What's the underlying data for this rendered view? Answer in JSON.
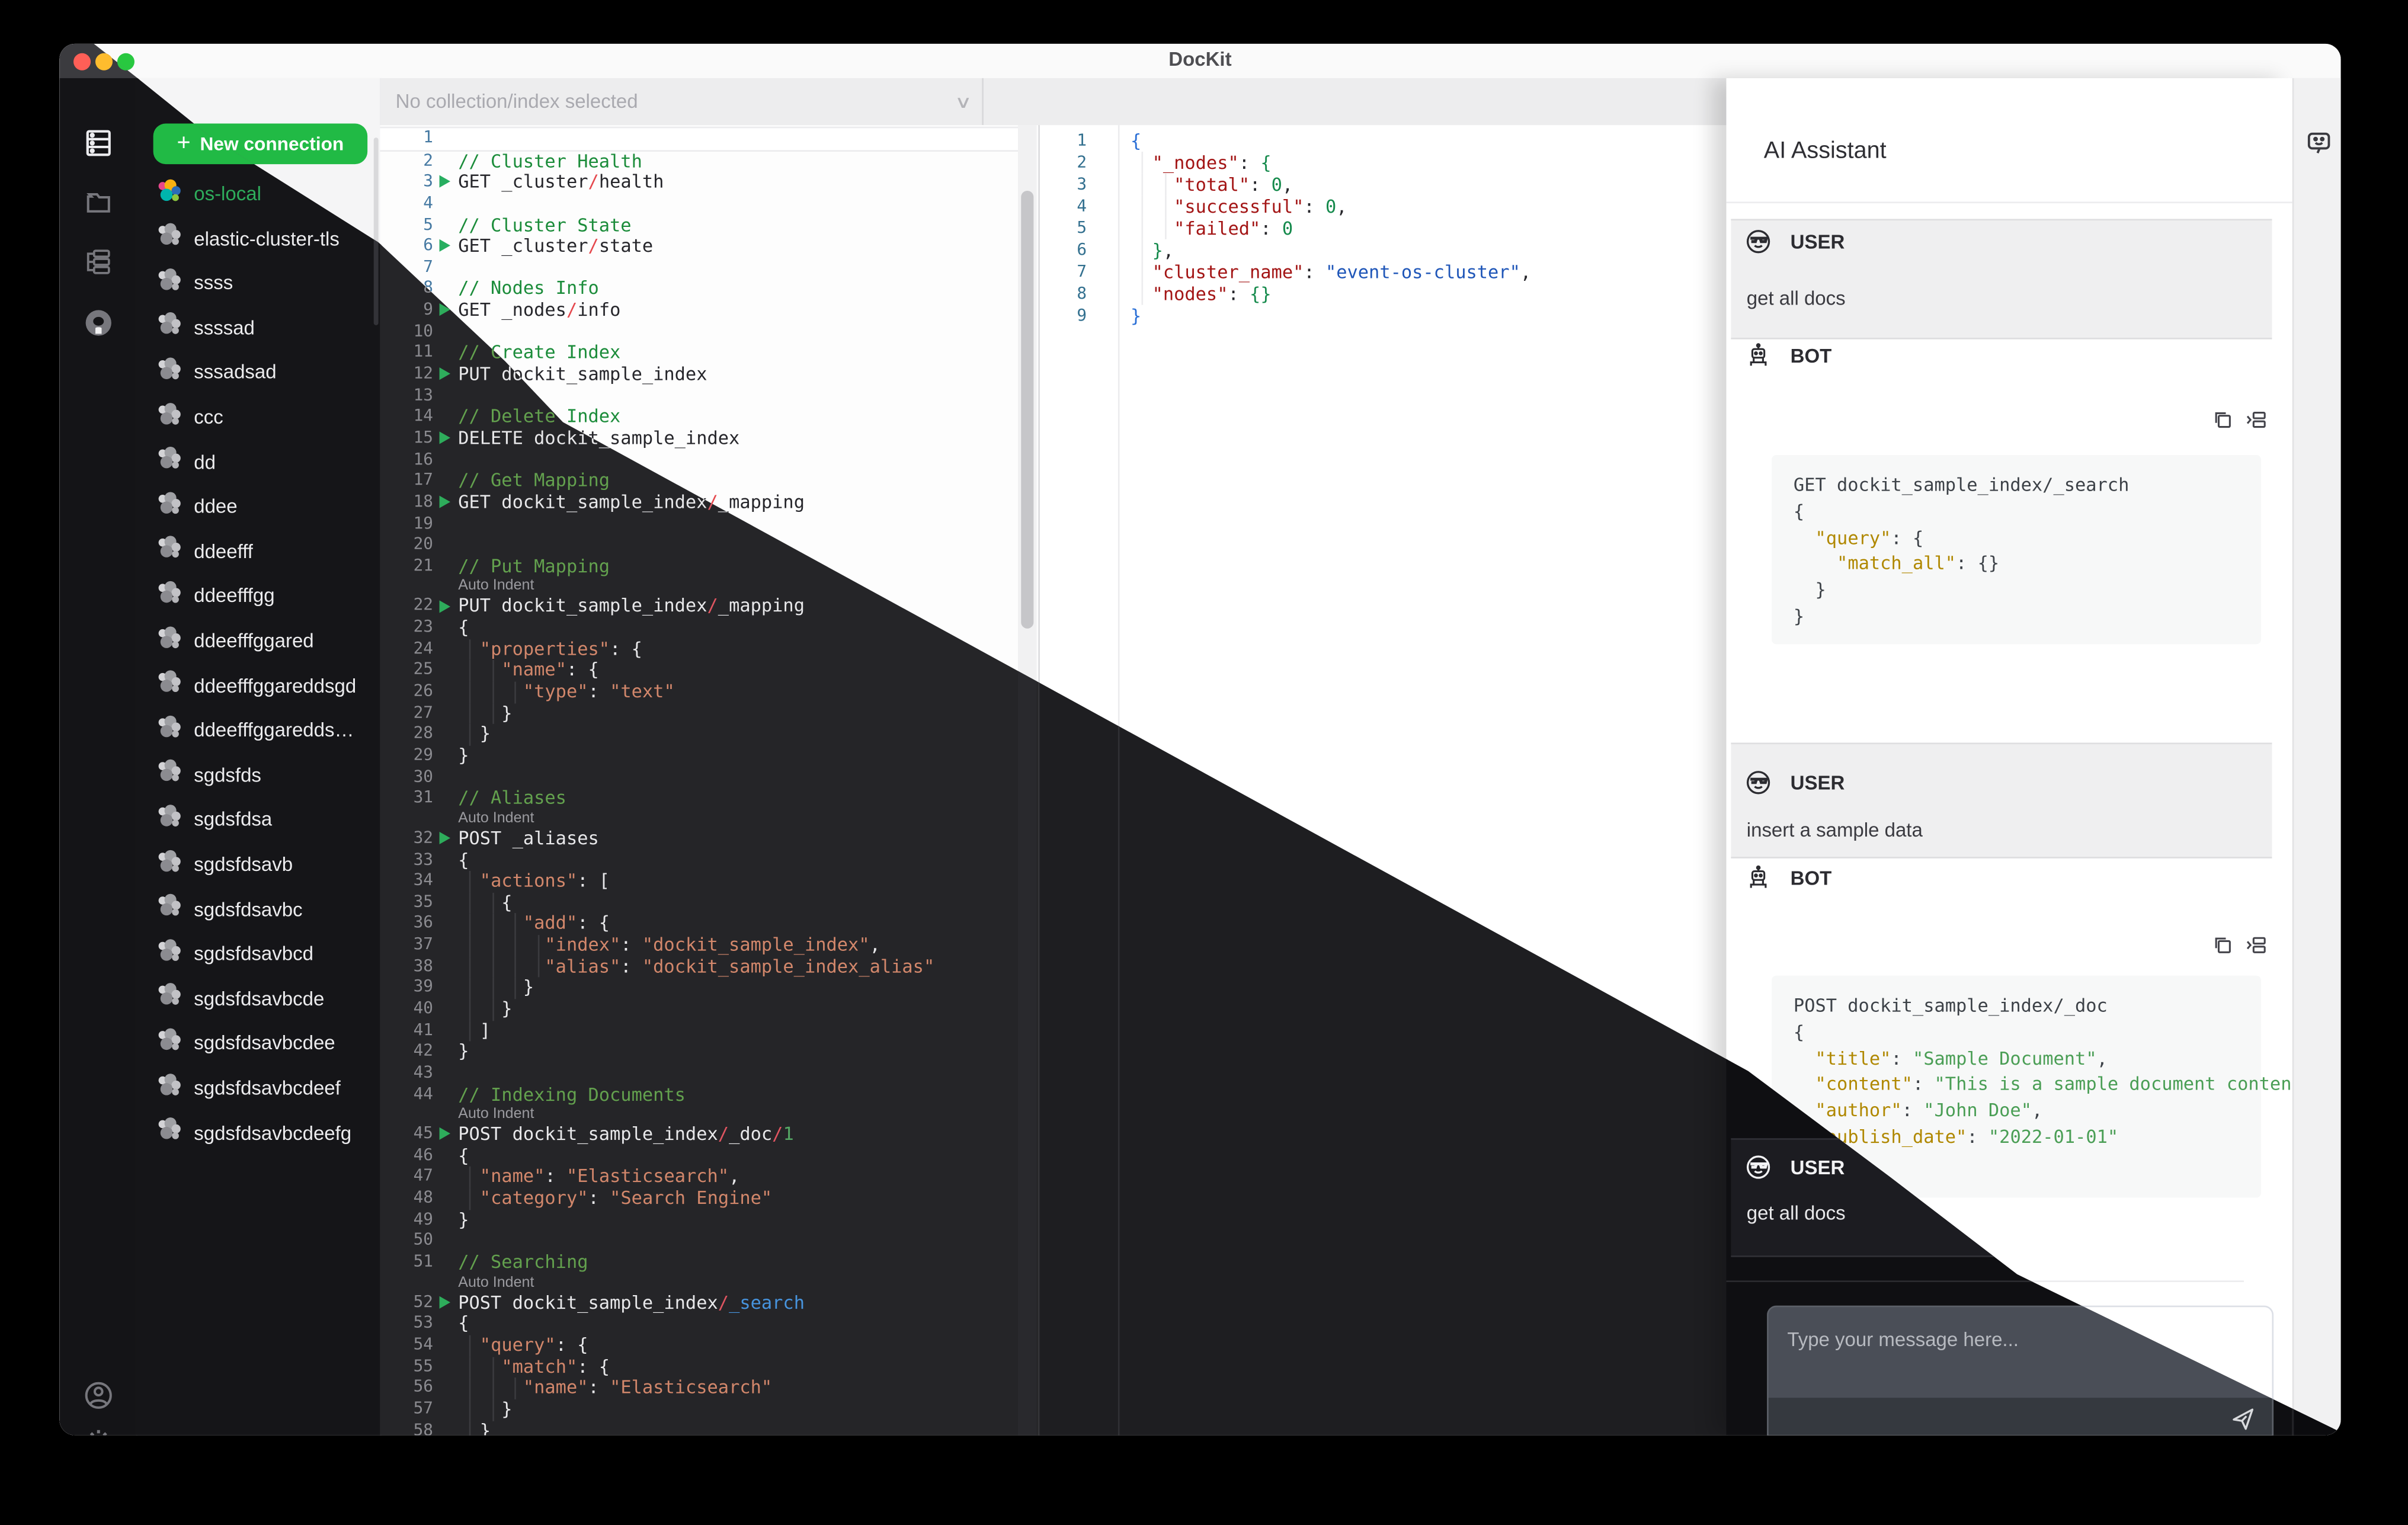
{
  "window": {
    "title": "DocKit"
  },
  "toolbar": {
    "collection_dropdown": "No collection/index selected",
    "chevron_icon": "chevron-down"
  },
  "rail": {
    "icons": [
      "server-connections-icon",
      "folder-icon",
      "tree-structure-icon",
      "github-icon",
      "user-circle-icon",
      "gear-icon"
    ]
  },
  "connections": {
    "new_button_label": "New connection",
    "items": [
      {
        "name": "os-local",
        "active": true
      },
      {
        "name": "elastic-cluster-tls",
        "active": false
      },
      {
        "name": "ssss",
        "active": false
      },
      {
        "name": "ssssad",
        "active": false
      },
      {
        "name": "sssadsad",
        "active": false
      },
      {
        "name": "ccc",
        "active": false
      },
      {
        "name": "dd",
        "active": false
      },
      {
        "name": "ddee",
        "active": false
      },
      {
        "name": "ddeefff",
        "active": false
      },
      {
        "name": "ddeefffgg",
        "active": false
      },
      {
        "name": "ddeefffggared",
        "active": false
      },
      {
        "name": "ddeefffggareddsgd",
        "active": false
      },
      {
        "name": "ddeefffggareddsgda…",
        "active": false
      },
      {
        "name": "sgdsfds",
        "active": false
      },
      {
        "name": "sgdsfdsa",
        "active": false
      },
      {
        "name": "sgdsfdsavb",
        "active": false
      },
      {
        "name": "sgdsfdsavbc",
        "active": false
      },
      {
        "name": "sgdsfdsavbcd",
        "active": false
      },
      {
        "name": "sgdsfdsavbcde",
        "active": false
      },
      {
        "name": "sgdsfdsavbcdee",
        "active": false
      },
      {
        "name": "sgdsfdsavbcdeef",
        "active": false
      },
      {
        "name": "sgdsfdsavbcdeefg",
        "active": false
      }
    ]
  },
  "editor": {
    "widget_label": "Auto Indent",
    "lines": [
      {
        "n": 1,
        "t": [],
        "active": true
      },
      {
        "n": 2,
        "t": [
          [
            "c",
            "// Cluster Health"
          ]
        ]
      },
      {
        "n": 3,
        "a": true,
        "t": [
          [
            "p",
            "GET _cluster"
          ],
          [
            "s",
            "/"
          ],
          [
            "p",
            "health"
          ]
        ]
      },
      {
        "n": 4,
        "t": []
      },
      {
        "n": 5,
        "t": [
          [
            "c",
            "// Cluster State"
          ]
        ]
      },
      {
        "n": 6,
        "a": true,
        "t": [
          [
            "p",
            "GET _cluster"
          ],
          [
            "s",
            "/"
          ],
          [
            "p",
            "state"
          ]
        ]
      },
      {
        "n": 7,
        "t": []
      },
      {
        "n": 8,
        "t": [
          [
            "c",
            "// Nodes Info"
          ]
        ]
      },
      {
        "n": 9,
        "a": true,
        "t": [
          [
            "p",
            "GET _nodes"
          ],
          [
            "s",
            "/"
          ],
          [
            "p",
            "info"
          ]
        ]
      },
      {
        "n": 10,
        "t": []
      },
      {
        "n": 11,
        "t": [
          [
            "c",
            "// Create Index"
          ]
        ]
      },
      {
        "n": 12,
        "a": true,
        "t": [
          [
            "p",
            "PUT dockit_sample_index"
          ]
        ]
      },
      {
        "n": 13,
        "t": []
      },
      {
        "n": 14,
        "t": [
          [
            "c",
            "// Delete Index"
          ]
        ]
      },
      {
        "n": 15,
        "a": true,
        "t": [
          [
            "p",
            "DELETE dockit_sample_index"
          ]
        ]
      },
      {
        "n": 16,
        "t": []
      },
      {
        "n": 17,
        "t": [
          [
            "c",
            "// Get Mapping"
          ]
        ]
      },
      {
        "n": 18,
        "a": true,
        "t": [
          [
            "p",
            "GET dockit_sample_index"
          ],
          [
            "s",
            "/"
          ],
          [
            "p",
            "_mapping"
          ]
        ]
      },
      {
        "n": 19,
        "t": []
      },
      {
        "n": 20,
        "t": []
      },
      {
        "n": 21,
        "t": [
          [
            "c",
            "// Put Mapping"
          ]
        ]
      },
      {
        "widget": true
      },
      {
        "n": 22,
        "a": true,
        "t": [
          [
            "p",
            "PUT dockit_sample_index"
          ],
          [
            "s",
            "/"
          ],
          [
            "p",
            "_mapping"
          ]
        ]
      },
      {
        "n": 23,
        "t": [
          [
            "p",
            "{"
          ]
        ]
      },
      {
        "n": 24,
        "t": [
          [
            "p",
            "  "
          ],
          [
            "k",
            "\"properties\""
          ],
          [
            "p",
            ": {"
          ]
        ]
      },
      {
        "n": 25,
        "t": [
          [
            "p",
            "    "
          ],
          [
            "k",
            "\"name\""
          ],
          [
            "p",
            ": {"
          ]
        ]
      },
      {
        "n": 26,
        "t": [
          [
            "p",
            "      "
          ],
          [
            "k",
            "\"type\""
          ],
          [
            "p",
            ": "
          ],
          [
            "v",
            "\"text\""
          ]
        ]
      },
      {
        "n": 27,
        "t": [
          [
            "p",
            "    }"
          ]
        ]
      },
      {
        "n": 28,
        "t": [
          [
            "p",
            "  }"
          ]
        ]
      },
      {
        "n": 29,
        "t": [
          [
            "p",
            "}"
          ]
        ]
      },
      {
        "n": 30,
        "t": []
      },
      {
        "n": 31,
        "t": [
          [
            "c",
            "// Aliases"
          ]
        ]
      },
      {
        "widget": true
      },
      {
        "n": 32,
        "a": true,
        "t": [
          [
            "p",
            "POST _aliases"
          ]
        ]
      },
      {
        "n": 33,
        "t": [
          [
            "p",
            "{"
          ]
        ]
      },
      {
        "n": 34,
        "t": [
          [
            "p",
            "  "
          ],
          [
            "k",
            "\"actions\""
          ],
          [
            "p",
            ": ["
          ]
        ]
      },
      {
        "n": 35,
        "t": [
          [
            "p",
            "    {"
          ]
        ]
      },
      {
        "n": 36,
        "t": [
          [
            "p",
            "      "
          ],
          [
            "k",
            "\"add\""
          ],
          [
            "p",
            ": {"
          ]
        ]
      },
      {
        "n": 37,
        "t": [
          [
            "p",
            "        "
          ],
          [
            "k",
            "\"index\""
          ],
          [
            "p",
            ": "
          ],
          [
            "v",
            "\"dockit_sample_index\""
          ],
          [
            "p",
            ","
          ]
        ]
      },
      {
        "n": 38,
        "t": [
          [
            "p",
            "        "
          ],
          [
            "k",
            "\"alias\""
          ],
          [
            "p",
            ": "
          ],
          [
            "v",
            "\"dockit_sample_index_alias\""
          ]
        ]
      },
      {
        "n": 39,
        "t": [
          [
            "p",
            "      }"
          ]
        ]
      },
      {
        "n": 40,
        "t": [
          [
            "p",
            "    }"
          ]
        ]
      },
      {
        "n": 41,
        "t": [
          [
            "p",
            "  ]"
          ]
        ]
      },
      {
        "n": 42,
        "t": [
          [
            "p",
            "}"
          ]
        ]
      },
      {
        "n": 43,
        "t": []
      },
      {
        "n": 44,
        "t": [
          [
            "c",
            "// Indexing Documents"
          ]
        ]
      },
      {
        "widget": true
      },
      {
        "n": 45,
        "a": true,
        "t": [
          [
            "p",
            "POST dockit_sample_index"
          ],
          [
            "s",
            "/"
          ],
          [
            "p",
            "_doc"
          ],
          [
            "s",
            "/"
          ],
          [
            "n2",
            "1"
          ]
        ]
      },
      {
        "n": 46,
        "t": [
          [
            "p",
            "{"
          ]
        ]
      },
      {
        "n": 47,
        "t": [
          [
            "p",
            "  "
          ],
          [
            "k",
            "\"name\""
          ],
          [
            "p",
            ": "
          ],
          [
            "v",
            "\"Elasticsearch\""
          ],
          [
            "p",
            ","
          ]
        ]
      },
      {
        "n": 48,
        "t": [
          [
            "p",
            "  "
          ],
          [
            "k",
            "\"category\""
          ],
          [
            "p",
            ": "
          ],
          [
            "v",
            "\"Search Engine\""
          ]
        ]
      },
      {
        "n": 49,
        "t": [
          [
            "p",
            "}"
          ]
        ]
      },
      {
        "n": 50,
        "t": []
      },
      {
        "n": 51,
        "t": [
          [
            "c",
            "// Searching"
          ]
        ]
      },
      {
        "widget": true
      },
      {
        "n": 52,
        "a": true,
        "t": [
          [
            "p",
            "POST dockit_sample_index"
          ],
          [
            "s",
            "/"
          ],
          [
            "b",
            "_search"
          ]
        ]
      },
      {
        "n": 53,
        "t": [
          [
            "p",
            "{"
          ]
        ]
      },
      {
        "n": 54,
        "t": [
          [
            "p",
            "  "
          ],
          [
            "k",
            "\"query\""
          ],
          [
            "p",
            ": {"
          ]
        ]
      },
      {
        "n": 55,
        "t": [
          [
            "p",
            "    "
          ],
          [
            "k",
            "\"match\""
          ],
          [
            "p",
            ": {"
          ]
        ]
      },
      {
        "n": 56,
        "t": [
          [
            "p",
            "      "
          ],
          [
            "k",
            "\"name\""
          ],
          [
            "p",
            ": "
          ],
          [
            "v",
            "\"Elasticsearch\""
          ]
        ]
      },
      {
        "n": 57,
        "t": [
          [
            "p",
            "    }"
          ]
        ]
      },
      {
        "n": 58,
        "t": [
          [
            "p",
            "  }"
          ]
        ]
      }
    ]
  },
  "results": {
    "lines": [
      {
        "n": 1,
        "t": [
          [
            "b0",
            "{"
          ]
        ]
      },
      {
        "n": 2,
        "t": [
          [
            "p",
            "  "
          ],
          [
            "k",
            "\"_nodes\""
          ],
          [
            "p",
            ": "
          ],
          [
            "b1",
            "{"
          ]
        ]
      },
      {
        "n": 3,
        "t": [
          [
            "p",
            "    "
          ],
          [
            "k",
            "\"total\""
          ],
          [
            "p",
            ": "
          ],
          [
            "n2",
            "0"
          ],
          [
            "p",
            ","
          ]
        ]
      },
      {
        "n": 4,
        "t": [
          [
            "p",
            "    "
          ],
          [
            "k",
            "\"successful\""
          ],
          [
            "p",
            ": "
          ],
          [
            "n2",
            "0"
          ],
          [
            "p",
            ","
          ]
        ]
      },
      {
        "n": 5,
        "t": [
          [
            "p",
            "    "
          ],
          [
            "k",
            "\"failed\""
          ],
          [
            "p",
            ": "
          ],
          [
            "n2",
            "0"
          ]
        ]
      },
      {
        "n": 6,
        "t": [
          [
            "p",
            "  "
          ],
          [
            "b1",
            "}"
          ],
          [
            "p",
            ","
          ]
        ]
      },
      {
        "n": 7,
        "t": [
          [
            "p",
            "  "
          ],
          [
            "k",
            "\"cluster_name\""
          ],
          [
            "p",
            ": "
          ],
          [
            "v",
            "\"event-os-cluster\""
          ],
          [
            "p",
            ","
          ]
        ]
      },
      {
        "n": 8,
        "t": [
          [
            "p",
            "  "
          ],
          [
            "k",
            "\"nodes\""
          ],
          [
            "p",
            ": "
          ],
          [
            "b1",
            "{}"
          ]
        ]
      },
      {
        "n": 9,
        "t": [
          [
            "b0",
            "}"
          ]
        ]
      }
    ]
  },
  "ai": {
    "header": "AI Assistant",
    "user_label": "USER",
    "bot_label": "BOT",
    "header_icon": "chat-bubble-smiley-icon",
    "message_icons": [
      "copy-icon",
      "insert-to-editor-icon"
    ],
    "messages": [
      {
        "role": "USER",
        "text": "get all docs"
      },
      {
        "role": "BOT",
        "code": [
          [
            [
              "p",
              "GET dockit_sample_index/_search"
            ]
          ],
          [
            [
              "p",
              "{"
            ]
          ],
          [
            [
              "p",
              "  "
            ],
            [
              "k",
              "\"query\""
            ],
            [
              "p",
              ": {"
            ]
          ],
          [
            [
              "p",
              "    "
            ],
            [
              "k",
              "\"match_all\""
            ],
            [
              "p",
              ": {}"
            ]
          ],
          [
            [
              "p",
              "  }"
            ]
          ],
          [
            [
              "p",
              "}"
            ]
          ]
        ]
      },
      {
        "role": "USER",
        "text": "insert a sample data"
      },
      {
        "role": "BOT",
        "code": [
          [
            [
              "p",
              "POST dockit_sample_index/_doc"
            ]
          ],
          [
            [
              "p",
              "{"
            ]
          ],
          [
            [
              "p",
              "  "
            ],
            [
              "k",
              "\"title\""
            ],
            [
              "p",
              ": "
            ],
            [
              "v",
              "\"Sample Document\""
            ],
            [
              "p",
              ","
            ]
          ],
          [
            [
              "p",
              "  "
            ],
            [
              "k",
              "\"content\""
            ],
            [
              "p",
              ": "
            ],
            [
              "v",
              "\"This is a sample document content\""
            ],
            [
              "p",
              ","
            ]
          ],
          [
            [
              "p",
              "  "
            ],
            [
              "k",
              "\"author\""
            ],
            [
              "p",
              ": "
            ],
            [
              "v",
              "\"John Doe\""
            ],
            [
              "p",
              ","
            ]
          ],
          [
            [
              "p",
              "  "
            ],
            [
              "k",
              "\"publish_date\""
            ],
            [
              "p",
              ": "
            ],
            [
              "v",
              "\"2022-01-01\""
            ]
          ],
          [
            [
              "p",
              "}"
            ]
          ]
        ]
      },
      {
        "role": "USER",
        "text": "get all docs",
        "glitch_layer_only": true
      }
    ],
    "input_placeholder": "Type your message here...",
    "send_icon": "paper-plane-icon"
  },
  "colors": {
    "accent_green": "#21ba45",
    "traffic_red": "#ff5f57",
    "traffic_yellow": "#febc2e",
    "traffic_green": "#28c840",
    "glitch_dark_editor_bg": "#252528",
    "glitch_dark_panel_bg": "#151518"
  }
}
